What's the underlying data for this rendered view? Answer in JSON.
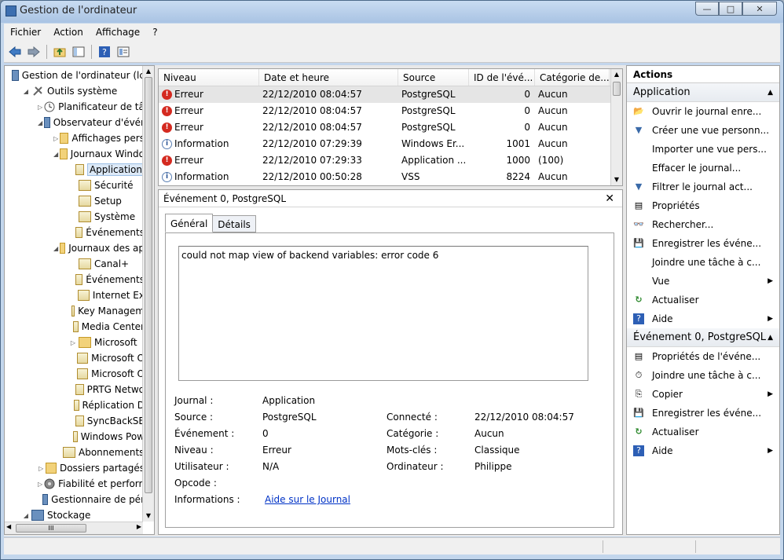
{
  "window": {
    "title": "Gestion de l'ordinateur",
    "controls": {
      "minimize": "—",
      "maximize": "□",
      "close": "✕"
    }
  },
  "menu": [
    "Fichier",
    "Action",
    "Affichage",
    "?"
  ],
  "toolbar": {
    "icons": [
      "back-arrow-icon",
      "forward-arrow-icon",
      "up-folder-icon",
      "show-tree-icon",
      "help-icon",
      "properties-icon"
    ]
  },
  "tree": {
    "items": [
      {
        "label": "Gestion de l'ordinateur (lc",
        "level": 0,
        "exp": "",
        "icon": "computer-icon"
      },
      {
        "label": "Outils système",
        "level": 1,
        "exp": "◢",
        "icon": "tools-icon"
      },
      {
        "label": "Planificateur de tâc",
        "level": 2,
        "exp": "▷",
        "icon": "clock-icon"
      },
      {
        "label": "Observateur d'évér",
        "level": 2,
        "exp": "◢",
        "icon": "event-viewer-icon"
      },
      {
        "label": "Affichages pers",
        "level": 3,
        "exp": "▷",
        "icon": "folder-icon"
      },
      {
        "label": "Journaux Windo",
        "level": 3,
        "exp": "◢",
        "icon": "folder-icon"
      },
      {
        "label": "Application",
        "level": 4,
        "exp": "",
        "icon": "log-icon",
        "selected": true
      },
      {
        "label": "Sécurité",
        "level": 4,
        "exp": "",
        "icon": "log-icon"
      },
      {
        "label": "Setup",
        "level": 4,
        "exp": "",
        "icon": "log-icon"
      },
      {
        "label": "Système",
        "level": 4,
        "exp": "",
        "icon": "log-icon"
      },
      {
        "label": "Événements",
        "level": 4,
        "exp": "",
        "icon": "log-icon"
      },
      {
        "label": "Journaux des ap",
        "level": 3,
        "exp": "◢",
        "icon": "folder-icon"
      },
      {
        "label": "Canal+",
        "level": 4,
        "exp": "",
        "icon": "log-icon"
      },
      {
        "label": "Événements",
        "level": 4,
        "exp": "",
        "icon": "log-icon"
      },
      {
        "label": "Internet Ex",
        "level": 4,
        "exp": "",
        "icon": "log-icon"
      },
      {
        "label": "Key Managem",
        "level": 4,
        "exp": "",
        "icon": "log-icon"
      },
      {
        "label": "Media Center",
        "level": 4,
        "exp": "",
        "icon": "log-icon"
      },
      {
        "label": "Microsoft",
        "level": 4,
        "exp": "▷",
        "icon": "folder-icon"
      },
      {
        "label": "Microsoft O",
        "level": 4,
        "exp": "",
        "icon": "log-icon"
      },
      {
        "label": "Microsoft O",
        "level": 4,
        "exp": "",
        "icon": "log-icon"
      },
      {
        "label": "PRTG Netwo",
        "level": 4,
        "exp": "",
        "icon": "log-icon"
      },
      {
        "label": "Réplication D",
        "level": 4,
        "exp": "",
        "icon": "log-icon"
      },
      {
        "label": "SyncBackSE",
        "level": 4,
        "exp": "",
        "icon": "log-icon"
      },
      {
        "label": "Windows Pow",
        "level": 4,
        "exp": "",
        "icon": "log-icon"
      },
      {
        "label": "Abonnements",
        "level": 3,
        "exp": "",
        "icon": "subscriptions-icon"
      },
      {
        "label": "Dossiers partagés",
        "level": 2,
        "exp": "▷",
        "icon": "shared-folder-icon"
      },
      {
        "label": "Fiabilité et perform",
        "level": 2,
        "exp": "▷",
        "icon": "performance-icon"
      },
      {
        "label": "Gestionnaire de pér",
        "level": 2,
        "exp": "",
        "icon": "device-manager-icon"
      },
      {
        "label": "Stockage",
        "level": 1,
        "exp": "◢",
        "icon": "storage-icon"
      }
    ],
    "hscroll_label": "III"
  },
  "list": {
    "columns": [
      "Niveau",
      "Date et heure",
      "Source",
      "ID de l'évé...",
      "Catégorie de..."
    ],
    "rows": [
      {
        "level": "Erreur",
        "type": "error",
        "date": "22/12/2010 08:04:57",
        "source": "PostgreSQL",
        "id": "0",
        "category": "Aucun",
        "selected": true
      },
      {
        "level": "Erreur",
        "type": "error",
        "date": "22/12/2010 08:04:57",
        "source": "PostgreSQL",
        "id": "0",
        "category": "Aucun"
      },
      {
        "level": "Erreur",
        "type": "error",
        "date": "22/12/2010 08:04:57",
        "source": "PostgreSQL",
        "id": "0",
        "category": "Aucun"
      },
      {
        "level": "Information",
        "type": "info",
        "date": "22/12/2010 07:29:39",
        "source": "Windows Er...",
        "id": "1001",
        "category": "Aucun"
      },
      {
        "level": "Erreur",
        "type": "error",
        "date": "22/12/2010 07:29:33",
        "source": "Application ...",
        "id": "1000",
        "category": "(100)"
      },
      {
        "level": "Information",
        "type": "info",
        "date": "22/12/2010 00:50:28",
        "source": "VSS",
        "id": "8224",
        "category": "Aucun"
      }
    ]
  },
  "detail": {
    "header": "Événement 0, PostgreSQL",
    "close": "✕",
    "tabs": [
      "Général",
      "Détails"
    ],
    "message": "could not map view of backend variables: error code 6",
    "fields": {
      "journal_label": "Journal :",
      "journal_value": "Application",
      "source_label": "Source :",
      "source_value": "PostgreSQL",
      "connected_label": "Connecté :",
      "connected_value": "22/12/2010 08:04:57",
      "event_label": "Événement :",
      "event_value": "0",
      "category_label": "Catégorie :",
      "category_value": "Aucun",
      "level_label": "Niveau :",
      "level_value": "Erreur",
      "keywords_label": "Mots-clés :",
      "keywords_value": "Classique",
      "user_label": "Utilisateur :",
      "user_value": "N/A",
      "computer_label": "Ordinateur :",
      "computer_value": "Philippe",
      "opcode_label": "Opcode :",
      "info_label": "Informations :",
      "info_link": "Aide sur le Journal"
    }
  },
  "actions": {
    "header": "Actions",
    "section1": "Application",
    "items1": [
      {
        "label": "Ouvrir le journal enre...",
        "icon": "open-folder-icon",
        "glyph": "📂"
      },
      {
        "label": "Créer une vue personn...",
        "icon": "filter-icon",
        "glyph": "▼"
      },
      {
        "label": "Importer une vue pers...",
        "icon": "",
        "glyph": ""
      },
      {
        "label": "Effacer le journal...",
        "icon": "",
        "glyph": ""
      },
      {
        "label": "Filtrer le journal act...",
        "icon": "filter-icon",
        "glyph": "▼"
      },
      {
        "label": "Propriétés",
        "icon": "properties-icon",
        "glyph": "▤"
      },
      {
        "label": "Rechercher...",
        "icon": "binoculars-icon",
        "glyph": "👓"
      },
      {
        "label": "Enregistrer les événe...",
        "icon": "save-icon",
        "glyph": "💾"
      },
      {
        "label": "Joindre une tâche à c...",
        "icon": "",
        "glyph": ""
      },
      {
        "label": "Vue",
        "icon": "",
        "glyph": "",
        "submenu": true
      },
      {
        "label": "Actualiser",
        "icon": "refresh-icon",
        "glyph": "↻"
      },
      {
        "label": "Aide",
        "icon": "help-icon",
        "glyph": "?",
        "submenu": true
      }
    ],
    "section2": "Événement 0, PostgreSQL",
    "items2": [
      {
        "label": "Propriétés de l'événe...",
        "icon": "properties-icon",
        "glyph": "▤"
      },
      {
        "label": "Joindre une tâche à c...",
        "icon": "task-icon",
        "glyph": "⏱"
      },
      {
        "label": "Copier",
        "icon": "copy-icon",
        "glyph": "⎘",
        "submenu": true
      },
      {
        "label": "Enregistrer les événe...",
        "icon": "save-icon",
        "glyph": "💾"
      },
      {
        "label": "Actualiser",
        "icon": "refresh-icon",
        "glyph": "↻"
      },
      {
        "label": "Aide",
        "icon": "help-icon",
        "glyph": "?",
        "submenu": true
      }
    ]
  }
}
